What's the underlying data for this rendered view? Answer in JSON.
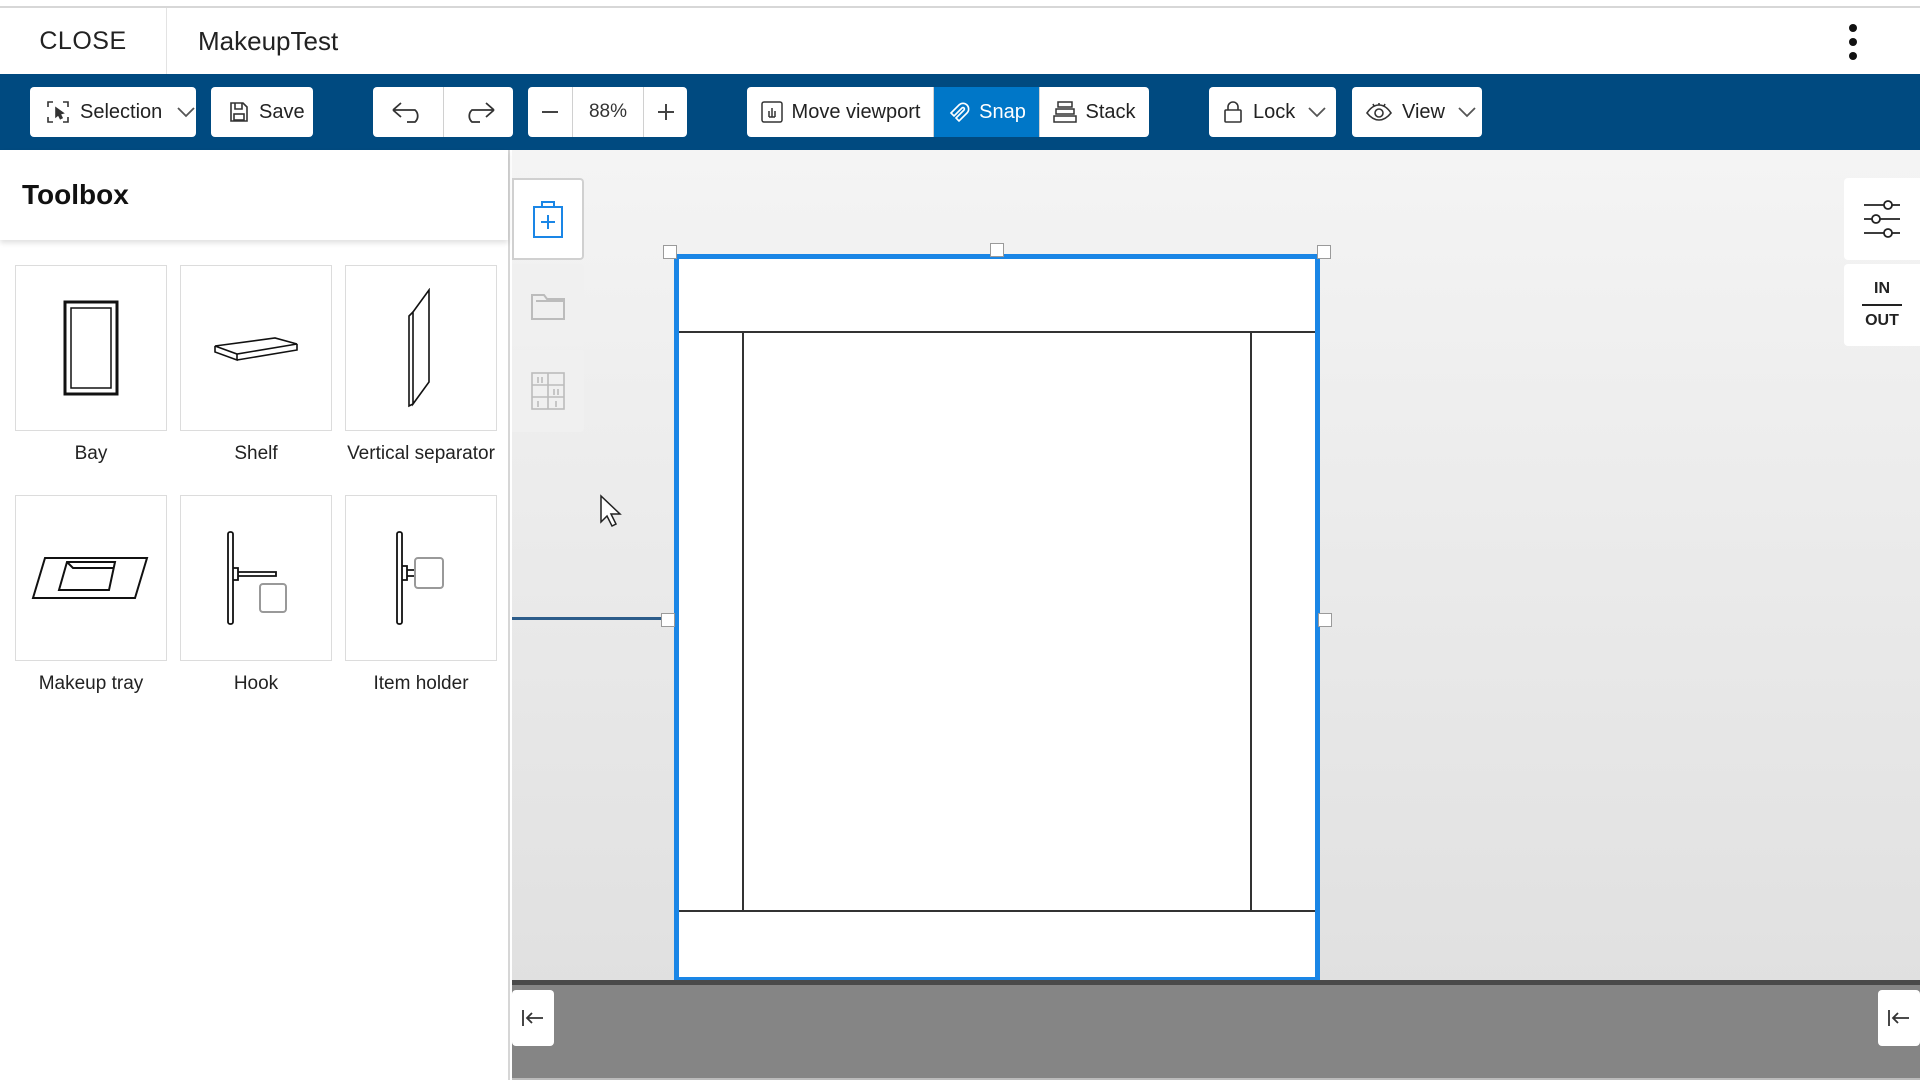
{
  "titlebar": {
    "close_label": "CLOSE",
    "document_title": "MakeupTest"
  },
  "toolbar": {
    "selection_label": "Selection",
    "save_label": "Save",
    "zoom_value": "88%",
    "move_viewport_label": "Move viewport",
    "snap_label": "Snap",
    "stack_label": "Stack",
    "lock_label": "Lock",
    "view_label": "View",
    "active_color": "#0077c8",
    "bar_color": "#004a80"
  },
  "toolbox": {
    "title": "Toolbox",
    "items": [
      {
        "label": "Bay",
        "icon": "bay-icon"
      },
      {
        "label": "Shelf",
        "icon": "shelf-icon"
      },
      {
        "label": "Vertical separator",
        "icon": "vertical-separator-icon"
      },
      {
        "label": "Makeup tray",
        "icon": "makeup-tray-icon"
      },
      {
        "label": "Hook",
        "icon": "hook-icon"
      },
      {
        "label": "Item holder",
        "icon": "item-holder-icon"
      }
    ]
  },
  "right_panel": {
    "in_label": "IN",
    "out_label": "OUT"
  },
  "canvas": {
    "selection_color": "#1a86e6",
    "floor_color": "#858585"
  }
}
